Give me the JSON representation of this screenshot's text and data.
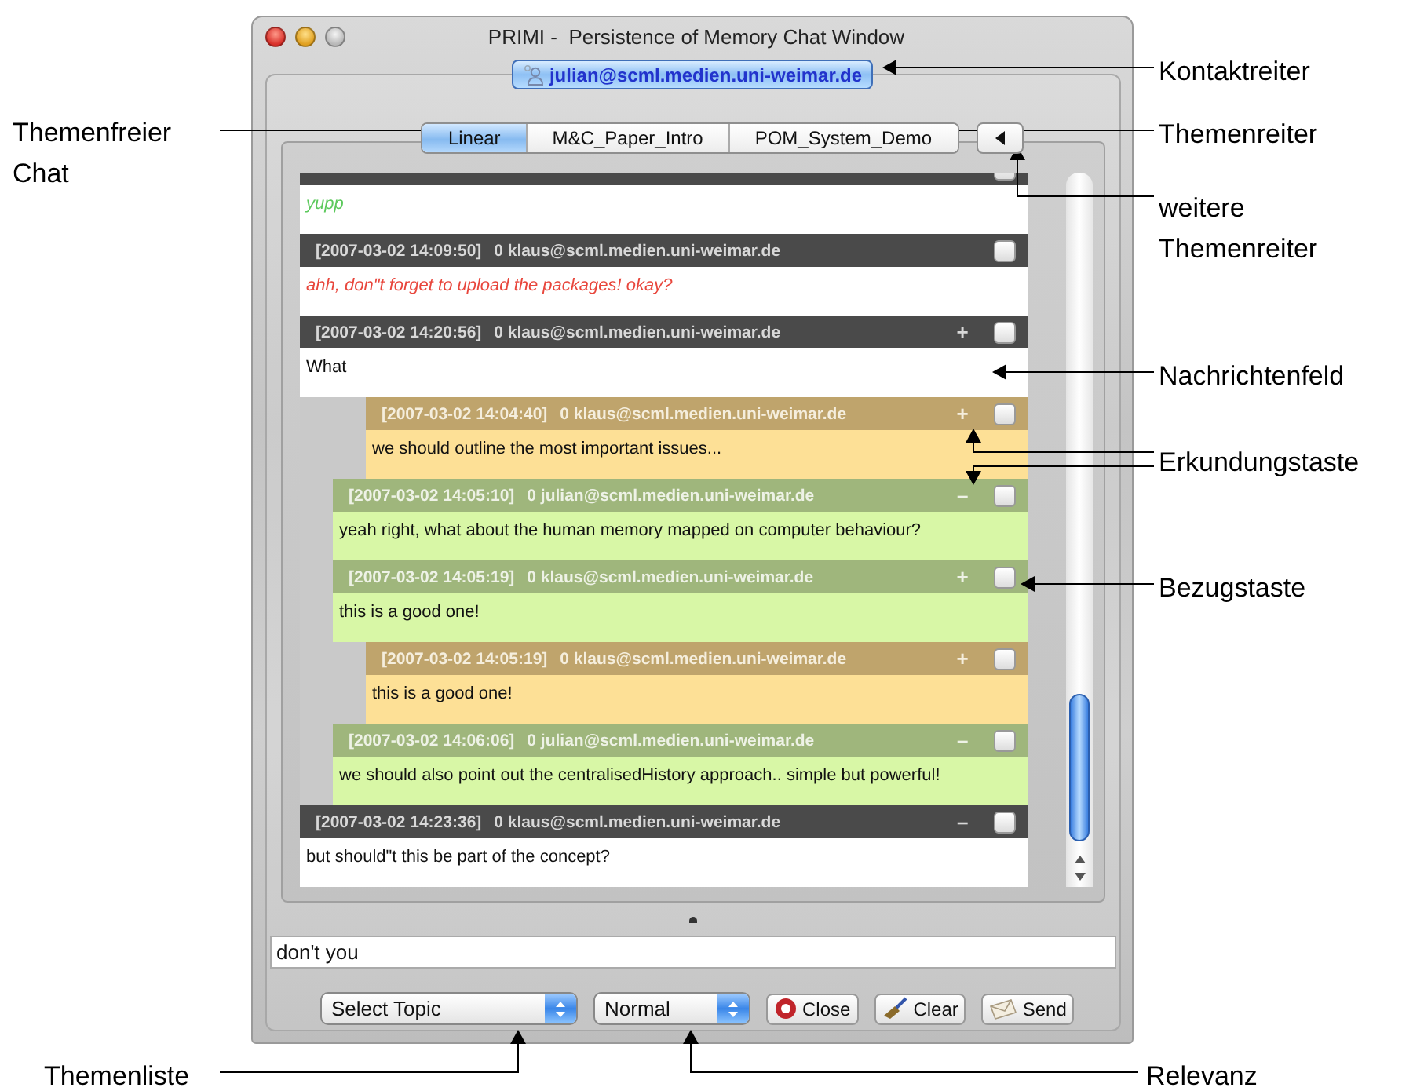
{
  "window": {
    "title": "PRIMI -  Persistence of Memory Chat Window"
  },
  "contact_tab": {
    "label": "julian@scml.medien.uni-weimar.de"
  },
  "topic_tabs": [
    {
      "label": "Linear",
      "selected": true
    },
    {
      "label": "M&C_Paper_Intro",
      "selected": false
    },
    {
      "label": "POM_System_Demo",
      "selected": false
    }
  ],
  "messages": [
    {
      "kind": "dark",
      "checked": false,
      "text": "yupp",
      "italic": true,
      "color": "#5cc95c"
    },
    {
      "kind": "dark",
      "timestamp": "[2007-03-02 14:09:50]",
      "sender": "0 klaus@scml.medien.uni-weimar.de",
      "checked": false,
      "text": "ahh, don\"t forget to upload the packages! okay?",
      "italic": true,
      "color": "#e8463c"
    },
    {
      "kind": "dark",
      "timestamp": "[2007-03-02 14:20:56]",
      "sender": "0 klaus@scml.medien.uni-weimar.de",
      "toggle": "+",
      "checked": false,
      "text": "What",
      "italic": false
    },
    {
      "kind": "orange",
      "timestamp": "[2007-03-02 14:04:40]",
      "sender": "0 klaus@scml.medien.uni-weimar.de",
      "toggle": "+",
      "checked": false,
      "text": "we should outline the most important issues...",
      "italic": false
    },
    {
      "kind": "green",
      "timestamp": "[2007-03-02 14:05:10]",
      "sender": "0 julian@scml.medien.uni-weimar.de",
      "toggle": "–",
      "checked": false,
      "text": "yeah right, what about the human memory mapped on computer behaviour?",
      "italic": false
    },
    {
      "kind": "green",
      "timestamp": "[2007-03-02 14:05:19]",
      "sender": "0 klaus@scml.medien.uni-weimar.de",
      "toggle": "+",
      "checked": false,
      "text": "this is a good one!",
      "italic": false
    },
    {
      "kind": "orange",
      "timestamp": "[2007-03-02 14:05:19]",
      "sender": "0 klaus@scml.medien.uni-weimar.de",
      "toggle": "+",
      "checked": false,
      "text": "this is a good one!",
      "italic": false
    },
    {
      "kind": "green",
      "timestamp": "[2007-03-02 14:06:06]",
      "sender": "0 julian@scml.medien.uni-weimar.de",
      "toggle": "–",
      "checked": false,
      "text": "we should also point out the centralisedHistory approach.. simple but powerful!",
      "italic": false
    },
    {
      "kind": "dark",
      "timestamp": "[2007-03-02 14:23:36]",
      "sender": "0 klaus@scml.medien.uni-weimar.de",
      "toggle": "–",
      "checked": false,
      "text": "but should\"t this be part of the concept?",
      "italic": false
    }
  ],
  "input": {
    "value": "don't you"
  },
  "topic_select": {
    "value": "Select Topic"
  },
  "relevance_select": {
    "value": "Normal"
  },
  "buttons": [
    {
      "label": "Close",
      "kind": "close"
    },
    {
      "label": "Clear",
      "kind": "clear"
    },
    {
      "label": "Send",
      "kind": "send"
    }
  ],
  "annotations": [
    {
      "text": "Kontaktreiter"
    },
    {
      "text": "Themenreiter"
    },
    {
      "text": "weitere Themenreiter"
    },
    {
      "text": "Themenfreier Chat"
    },
    {
      "text": "Nachrichtenfeld"
    },
    {
      "text": "Erkundungstaste"
    },
    {
      "text": "Bezugstaste"
    },
    {
      "text": "Themenliste"
    },
    {
      "text": "Relevanz"
    }
  ]
}
